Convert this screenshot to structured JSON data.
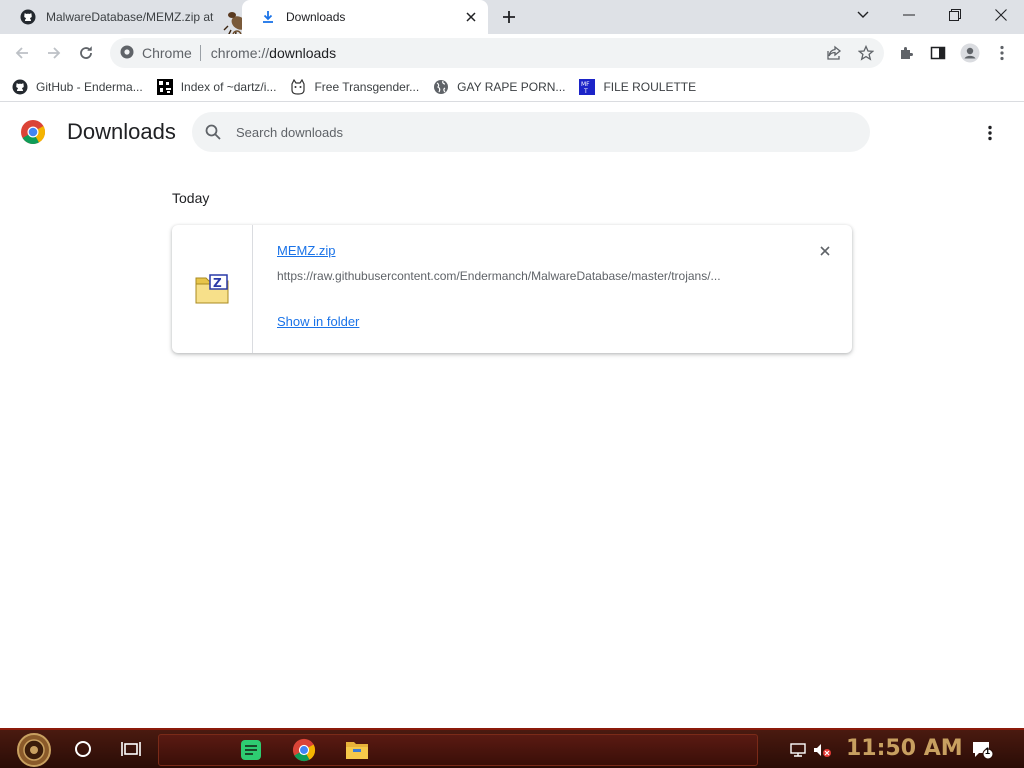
{
  "browser": {
    "tabs": [
      {
        "label": "MalwareDatabase/MEMZ.zip at",
        "icon": "github-icon",
        "active": false
      },
      {
        "label": "Downloads",
        "icon": "download-icon",
        "active": true
      }
    ],
    "omnibox": {
      "chip": "Chrome",
      "scheme": "chrome://",
      "host": "downloads"
    },
    "bookmarks": [
      {
        "label": "GitHub - Enderma...",
        "icon": "github-icon"
      },
      {
        "label": "Index of ~dartz/i...",
        "icon": "pixel-icon"
      },
      {
        "label": "Free Transgender...",
        "icon": "cat-icon"
      },
      {
        "label": "GAY RAPE PORN...",
        "icon": "globe-icon"
      },
      {
        "label": "FILE ROULETTE",
        "icon": "mft-icon"
      }
    ]
  },
  "downloads": {
    "title": "Downloads",
    "search_placeholder": "Search downloads",
    "section": "Today",
    "items": [
      {
        "file_name": "MEMZ.zip",
        "url": "https://raw.githubusercontent.com/Endermanch/MalwareDatabase/master/trojans/...",
        "action": "Show in folder",
        "icon": "zip-file-icon"
      }
    ]
  },
  "taskbar": {
    "time": "11:50 AM",
    "notification_count": "1",
    "accent": "#8b1a0a"
  }
}
